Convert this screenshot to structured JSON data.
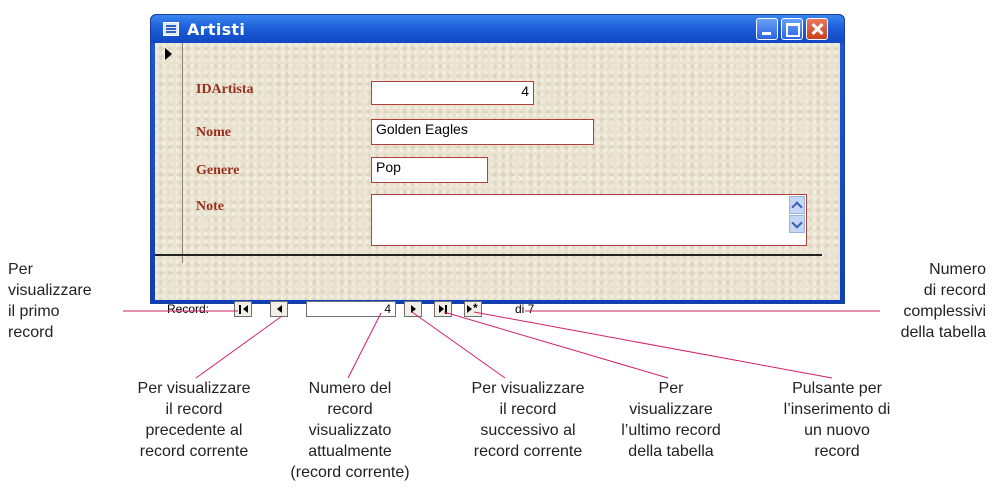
{
  "window": {
    "title": "Artisti"
  },
  "form": {
    "fields": [
      {
        "label": "IDArtista",
        "value": "4"
      },
      {
        "label": "Nome",
        "value": "Golden Eagles"
      },
      {
        "label": "Genere",
        "value": "Pop"
      },
      {
        "label": "Note",
        "value": ""
      }
    ]
  },
  "navigation": {
    "record_label": "Record:",
    "current_record": "4",
    "total_text": "di 7"
  },
  "annotations": {
    "first_record": [
      "Per",
      "visualizzare",
      "il primo",
      "record"
    ],
    "total_records": [
      "Numero",
      "di record",
      "complessivi",
      "della tabella"
    ],
    "previous_record": [
      "Per visualizzare",
      "il record",
      "precedente al",
      "record corrente"
    ],
    "current_record": [
      "Numero del",
      "record",
      "visualizzato",
      "attualmente",
      "(record corrente)"
    ],
    "next_record": [
      "Per visualizzare",
      "il record",
      "successivo al",
      "record corrente"
    ],
    "last_record": [
      "Per",
      "visualizzare",
      "l’ultimo record",
      "della tabella"
    ],
    "new_record": [
      "Pulsante per",
      "l’inserimento di",
      "un nuovo",
      "record"
    ]
  },
  "colors": {
    "title_bar": "#1d5fd9",
    "form_label": "#9a2e1c",
    "field_border": "#b04040",
    "callout_line": "#d0206a"
  }
}
